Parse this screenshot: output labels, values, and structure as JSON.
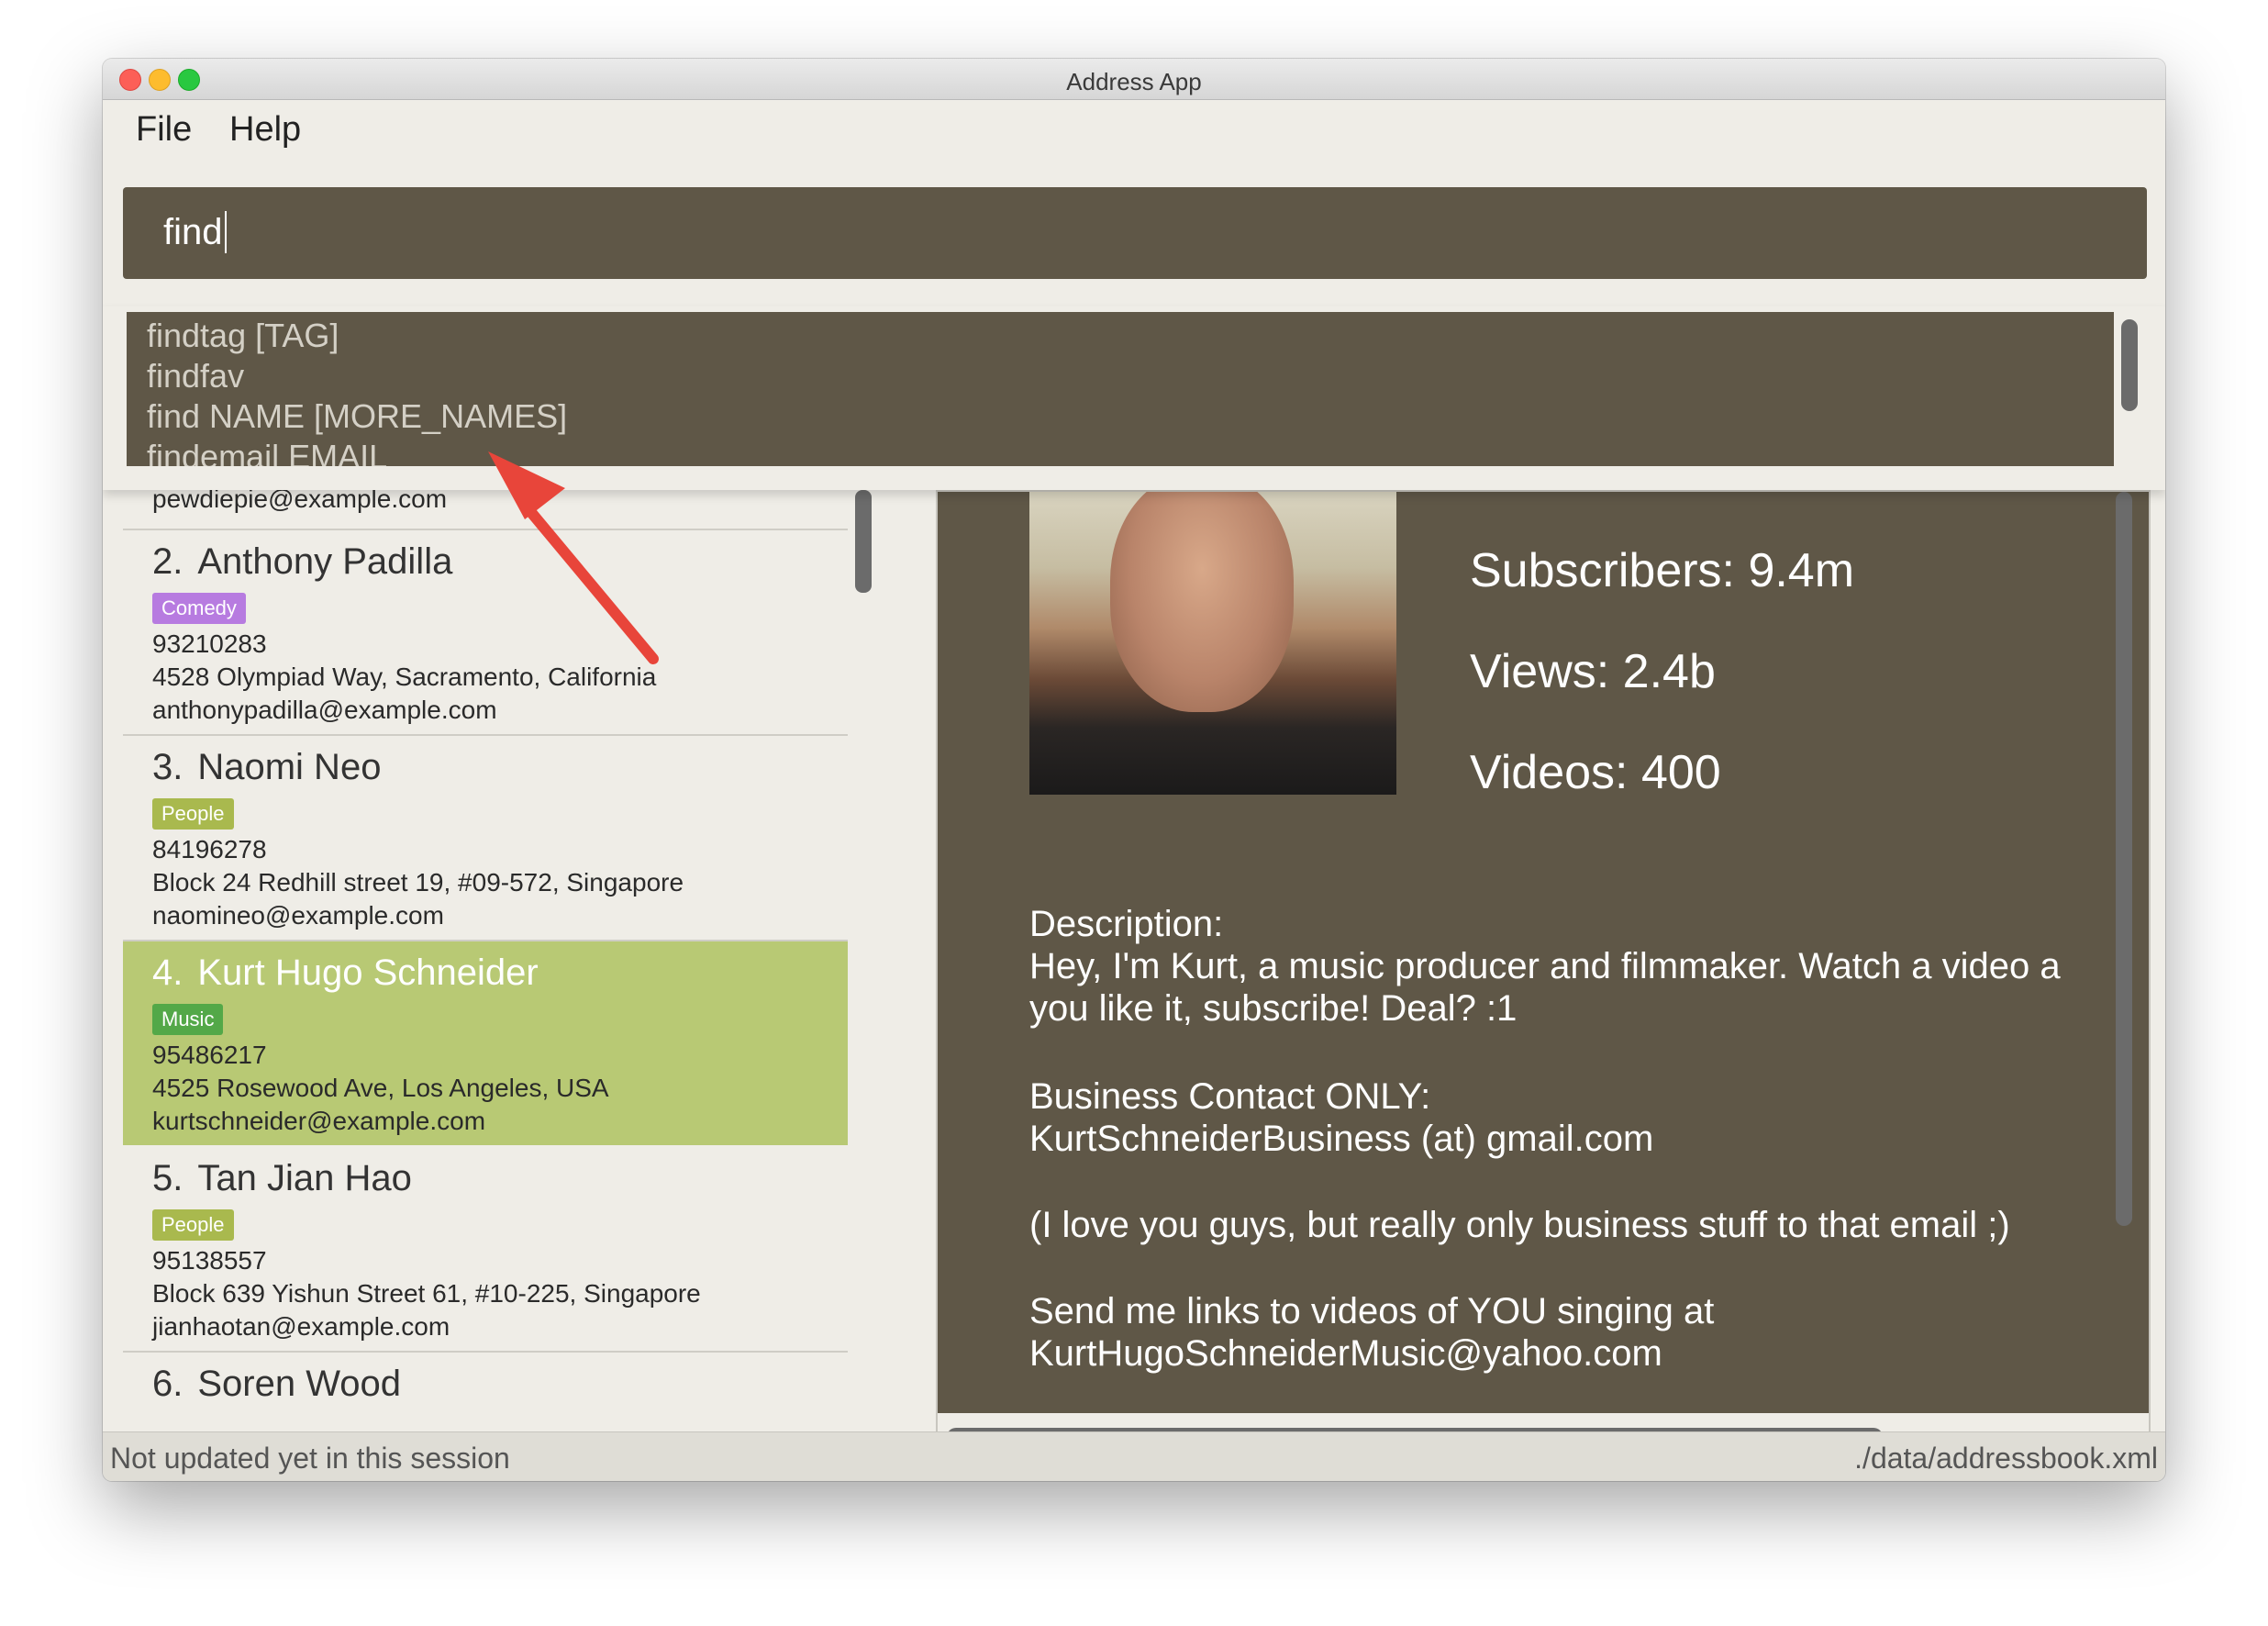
{
  "window": {
    "title": "Address App"
  },
  "menu": {
    "file": "File",
    "help": "Help"
  },
  "command": {
    "value": "find"
  },
  "suggestions": [
    "findtag [TAG]",
    "findfav",
    "find NAME [MORE_NAMES]",
    "findemail EMAIL"
  ],
  "list": {
    "partial_email": "pewdiepie@example.com",
    "people": [
      {
        "index": "2.",
        "name": "Anthony Padilla",
        "tag": "Comedy",
        "tag_color": "#b77be0",
        "phone": "93210283",
        "address": "4528 Olympiad Way, Sacramento, California",
        "email": "anthonypadilla@example.com"
      },
      {
        "index": "3.",
        "name": "Naomi Neo",
        "tag": "People",
        "tag_color": "#a9b94e",
        "phone": "84196278",
        "address": "Block 24 Redhill street 19, #09-572, Singapore",
        "email": "naomineo@example.com"
      },
      {
        "index": "4.",
        "name": "Kurt Hugo Schneider",
        "tag": "Music",
        "tag_color": "#53a848",
        "phone": "95486217",
        "address": "4525 Rosewood Ave, Los Angeles, USA",
        "email": "kurtschneider@example.com"
      },
      {
        "index": "5.",
        "name": "Tan Jian Hao",
        "tag": "People",
        "tag_color": "#a9b94e",
        "phone": "95138557",
        "address": "Block 639 Yishun Street 61, #10-225, Singapore",
        "email": "jianhaotan@example.com"
      },
      {
        "index": "6.",
        "name": "Soren Wood"
      }
    ]
  },
  "detail": {
    "subscribers": "Subscribers: 9.4m",
    "views": "Views: 2.4b",
    "videos": "Videos: 400",
    "description_label": "Description:",
    "description_1": "Hey, I'm Kurt, a music producer and filmmaker. Watch a video a",
    "description_2": "you like it, subscribe! Deal? :1",
    "business_label": "Business Contact ONLY:",
    "business_email": "KurtSchneiderBusiness (at) gmail.com",
    "note": "(I love you guys, but really only business stuff to that email ;)",
    "send_links": "Send me links to videos of YOU singing at",
    "music_email": "KurtHugoSchneiderMusic@yahoo.com"
  },
  "status": {
    "left": "Not updated yet in this session",
    "right": "./data/addressbook.xml"
  },
  "colors": {
    "panel": "#5f5747",
    "background": "#efede7",
    "selected": "#b8c974",
    "arrow": "#e8453a"
  }
}
